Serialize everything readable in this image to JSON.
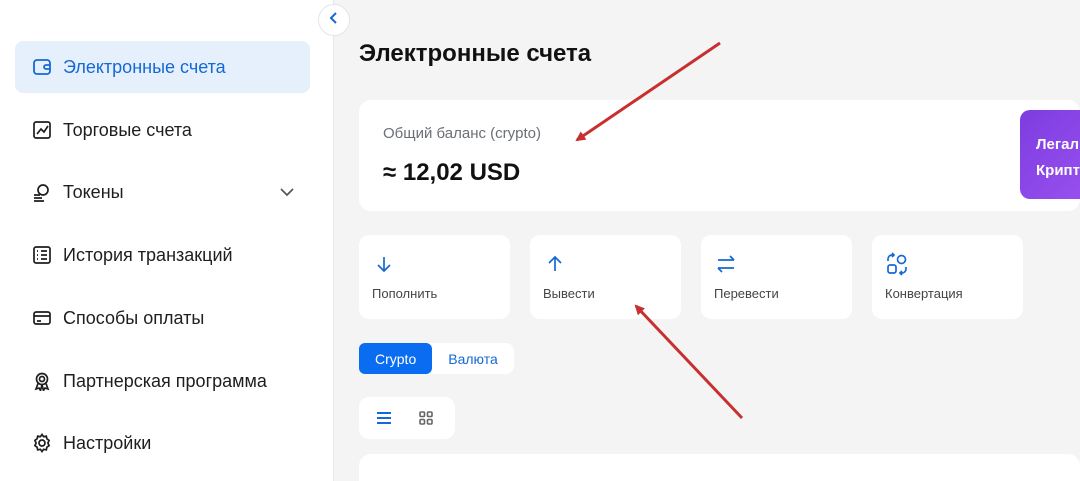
{
  "sidebar": {
    "items": [
      {
        "label": "Электронные счета",
        "icon": "wallet-icon",
        "active": true
      },
      {
        "label": "Торговые счета",
        "icon": "chart-icon"
      },
      {
        "label": "Токены",
        "icon": "coins-icon",
        "has_children": true
      },
      {
        "label": "История транзакций",
        "icon": "list-icon"
      },
      {
        "label": "Способы оплаты",
        "icon": "card-icon"
      },
      {
        "label": "Партнерская программа",
        "icon": "award-icon"
      },
      {
        "label": "Настройки",
        "icon": "gear-icon"
      }
    ]
  },
  "main": {
    "title": "Электронные счета",
    "balance": {
      "label": "Общий баланс (crypto)",
      "value": "≈ 12,02 USD"
    },
    "promo": {
      "line1": "Легал",
      "line2": "Крипт"
    },
    "actions": [
      {
        "label": "Пополнить",
        "icon": "arrow-down-icon"
      },
      {
        "label": "Вывести",
        "icon": "arrow-up-icon"
      },
      {
        "label": "Перевести",
        "icon": "transfer-icon"
      },
      {
        "label": "Конвертация",
        "icon": "convert-icon"
      }
    ],
    "tabs": [
      {
        "label": "Crypto",
        "active": true
      },
      {
        "label": "Валюта",
        "active": false
      }
    ],
    "view_modes": [
      "list-view-icon",
      "grid-view-icon"
    ]
  },
  "colors": {
    "accent": "#0a6cf0",
    "active_bg": "#e6f0fd",
    "annotation_arrow": "#c8302f",
    "promo_gradient": [
      "#7d3ce0",
      "#9b52f0"
    ]
  }
}
